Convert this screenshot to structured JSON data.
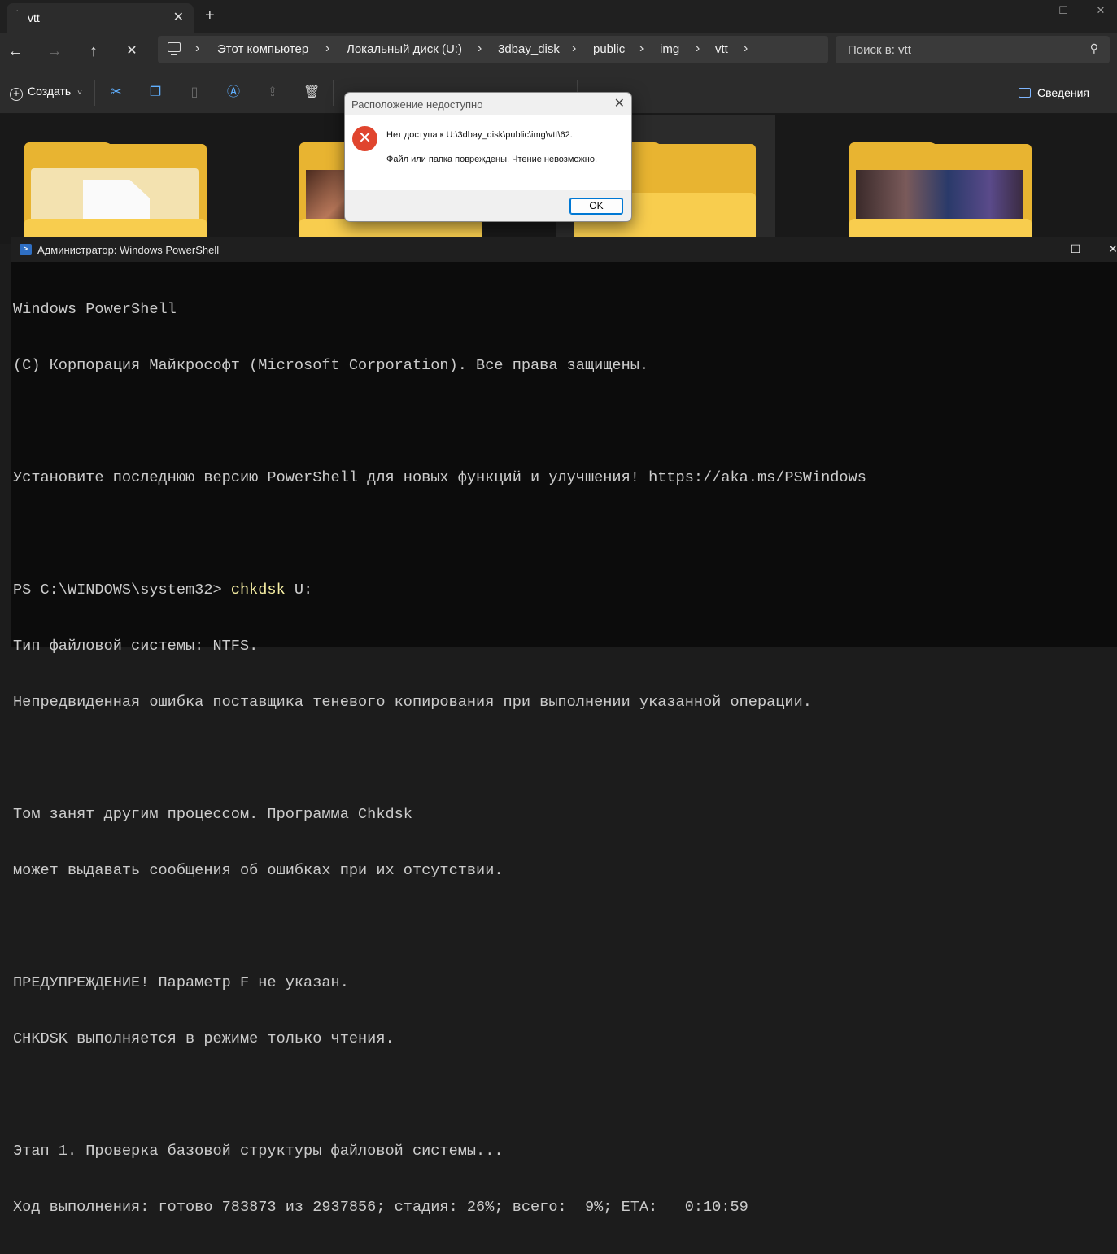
{
  "explorer": {
    "tab_title": "vtt",
    "window_controls": {
      "minimize": "—",
      "maximize": "☐",
      "close": "✕"
    },
    "nav": {
      "back": "←",
      "forward": "→",
      "up": "↑",
      "stop": "✕"
    },
    "breadcrumbs": [
      "Этот компьютер",
      "Локальный диск (U:)",
      "3dbay_disk",
      "public",
      "img",
      "vtt"
    ],
    "search_placeholder": "Поиск в: vtt",
    "toolbar": {
      "create_label": "Создать",
      "details_label": "Сведения",
      "icons": [
        "cut-icon",
        "copy-icon",
        "paste-icon",
        "rename-icon",
        "share-icon",
        "delete-icon"
      ]
    }
  },
  "dialog": {
    "title": "Расположение недоступно",
    "message_line1": "Нет доступа к U:\\3dbay_disk\\public\\img\\vtt\\62.",
    "message_line2": "Файл или папка повреждены. Чтение невозможно.",
    "ok_label": "OK",
    "icon": "error-icon",
    "accent_color": "#e0452e"
  },
  "powershell": {
    "title": "Администратор: Windows PowerShell",
    "lines": [
      "Windows PowerShell",
      "(C) Корпорация Майкрософт (Microsoft Corporation). Все права защищены.",
      "",
      "Установите последнюю версию PowerShell для новых функций и улучшения! https://aka.ms/PSWindows",
      "",
      "",
      "Тип файловой системы: NTFS.",
      "Непредвиденная ошибка поставщика теневого копирования при выполнении указанной операции.",
      "",
      "Том занят другим процессом. Программа Chkdsk",
      "может выдавать сообщения об ошибках при их отсутствии.",
      "",
      "ПРЕДУПРЕЖДЕНИЕ! Параметр F не указан.",
      "CHKDSK выполняется в режиме только чтения.",
      "",
      "Этап 1. Проверка базовой структуры файловой системы...",
      "Ход выполнения: готово 783873 из 2937856; стадия: 26%; всего:  9%; ETA:   0:10:59"
    ],
    "prompt": "PS C:\\WINDOWS\\system32> ",
    "command": "chkdsk",
    "command_arg": " U:"
  }
}
